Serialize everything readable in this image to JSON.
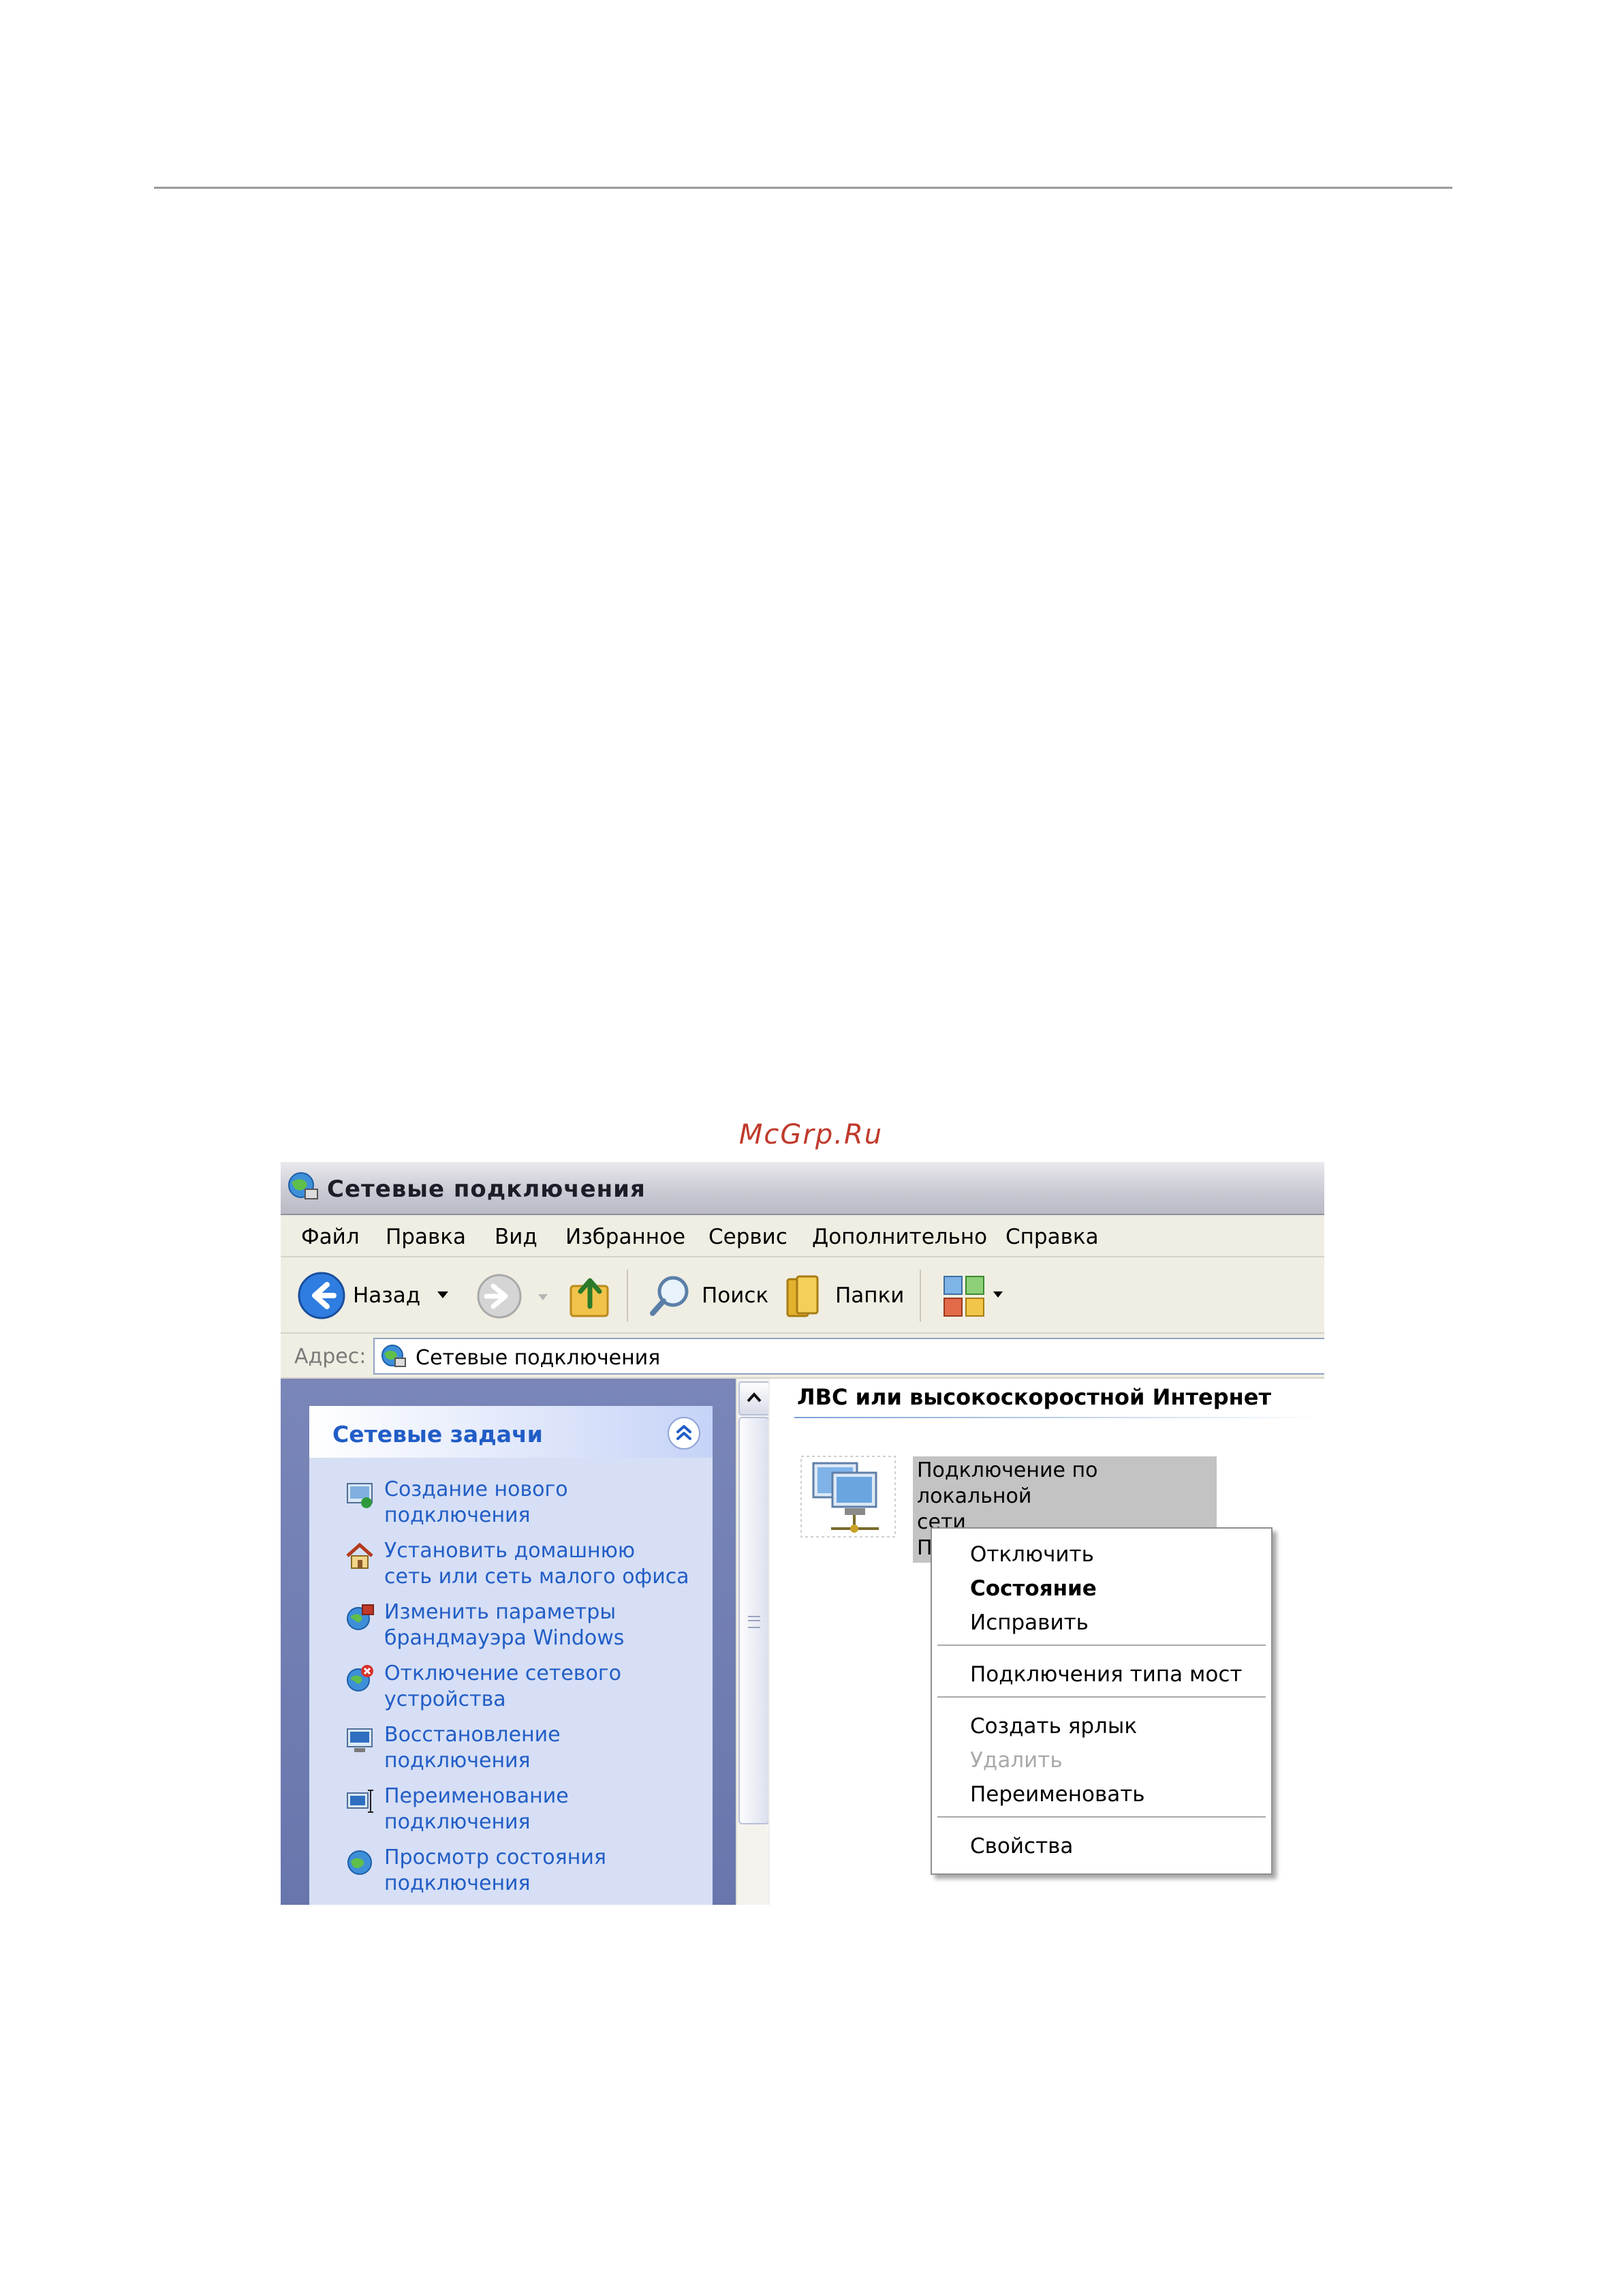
{
  "watermark": "McGrp.Ru",
  "window": {
    "title": "Сетевые подключения"
  },
  "menu": [
    "Файл",
    "Правка",
    "Вид",
    "Избранное",
    "Сервис",
    "Дополнительно",
    "Справка"
  ],
  "toolbar": {
    "back_label": "Назад",
    "search_label": "Поиск",
    "folders_label": "Папки"
  },
  "address": {
    "label": "Адрес:",
    "value": "Сетевые подключения"
  },
  "tasks": {
    "header": "Сетевые задачи",
    "items": [
      {
        "line1": "Создание нового",
        "line2": "подключения",
        "icon": "new-connection-icon"
      },
      {
        "line1": "Установить домашнюю",
        "line2": "сеть или сеть малого офиса",
        "icon": "home-network-icon"
      },
      {
        "line1": "Изменить параметры",
        "line2": "брандмауэра Windows",
        "icon": "firewall-icon"
      },
      {
        "line1": "Отключение сетевого",
        "line2": "устройства",
        "icon": "disable-device-icon"
      },
      {
        "line1": "Восстановление",
        "line2": "подключения",
        "icon": "repair-connection-icon"
      },
      {
        "line1": "Переименование",
        "line2": "подключения",
        "icon": "rename-connection-icon"
      },
      {
        "line1": "Просмотр состояния",
        "line2": "подключения",
        "icon": "view-status-icon"
      }
    ]
  },
  "content": {
    "group_header": "ЛВС или высокоскоростной Интернет",
    "connection": {
      "line1": "Подключение по локальной",
      "line2": "сети",
      "line3": "По"
    }
  },
  "context_menu": {
    "items": [
      {
        "label": "Отключить",
        "style": "normal"
      },
      {
        "label": "Состояние",
        "style": "bold"
      },
      {
        "label": "Исправить",
        "style": "normal"
      },
      {
        "label": "Подключения типа мост",
        "style": "normal"
      },
      {
        "label": "Создать ярлык",
        "style": "normal"
      },
      {
        "label": "Удалить",
        "style": "disabled"
      },
      {
        "label": "Переименовать",
        "style": "normal"
      },
      {
        "label": "Свойства",
        "style": "normal"
      }
    ]
  }
}
